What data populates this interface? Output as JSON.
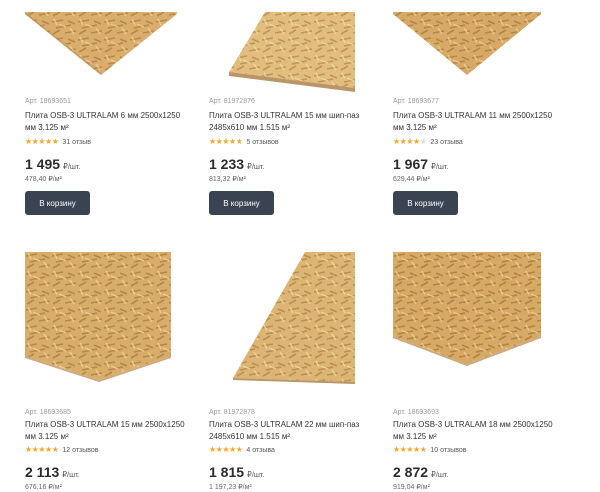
{
  "products": [
    {
      "article": "Арт. 18693651",
      "title": "Плита OSB-3 ULTRALAM 6 мм 2500x1250 мм 3.125 м²",
      "stars": 5,
      "reviews": "31 отзыв",
      "price": "1 495",
      "unit": "₽/шт.",
      "per_sqm": "478,40 ₽/м²",
      "button": "В корзину",
      "image": "osb-board-flat"
    },
    {
      "article": "Арт. 81972876",
      "title": "Плита OSB-3 ULTRALAM 15 мм шип-паз 2485x610 мм 1.515 м²",
      "stars": 5,
      "reviews": "5 отзывов",
      "price": "1 233",
      "unit": "₽/шт.",
      "per_sqm": "813,32 ₽/м²",
      "button": "В корзину",
      "image": "osb-board-angled"
    },
    {
      "article": "Арт. 18693677",
      "title": "Плита OSB-3 ULTRALAM 11 мм 2500x1250 мм 3.125 м²",
      "stars": 4,
      "reviews": "23 отзыва",
      "price": "1 967",
      "unit": "₽/шт.",
      "per_sqm": "629,44 ₽/м²",
      "button": "В корзину",
      "image": "osb-board-flat"
    },
    {
      "article": "Арт. 18693685",
      "title": "Плита OSB-3 ULTRALAM 15 мм 2500x1250 мм 3.125 м²",
      "stars": 5,
      "reviews": "12 отзывов",
      "price": "2 113",
      "unit": "₽/шт.",
      "per_sqm": "676,16 ₽/м²",
      "button": "",
      "image": "osb-board-flat"
    },
    {
      "article": "Арт. 81972878",
      "title": "Плита OSB-3 ULTRALAM 22 мм шип-паз 2485x610 мм 1.515 м²",
      "stars": 5,
      "reviews": "4 отзыва",
      "price": "1 815",
      "unit": "₽/шт.",
      "per_sqm": "1 197,23 ₽/м²",
      "button": "",
      "image": "osb-board-angled"
    },
    {
      "article": "Арт. 18693693",
      "title": "Плита OSB-3 ULTRALAM 18 мм 2500x1250 мм 3.125 м²",
      "stars": 5,
      "reviews": "10 отзывов",
      "price": "2 872",
      "unit": "₽/шт.",
      "per_sqm": "919,04 ₽/м²",
      "button": "",
      "image": "osb-board-flat"
    }
  ],
  "colors": {
    "button_bg": "#3a4352",
    "star": "#f5a623",
    "board": "#d4a765"
  }
}
